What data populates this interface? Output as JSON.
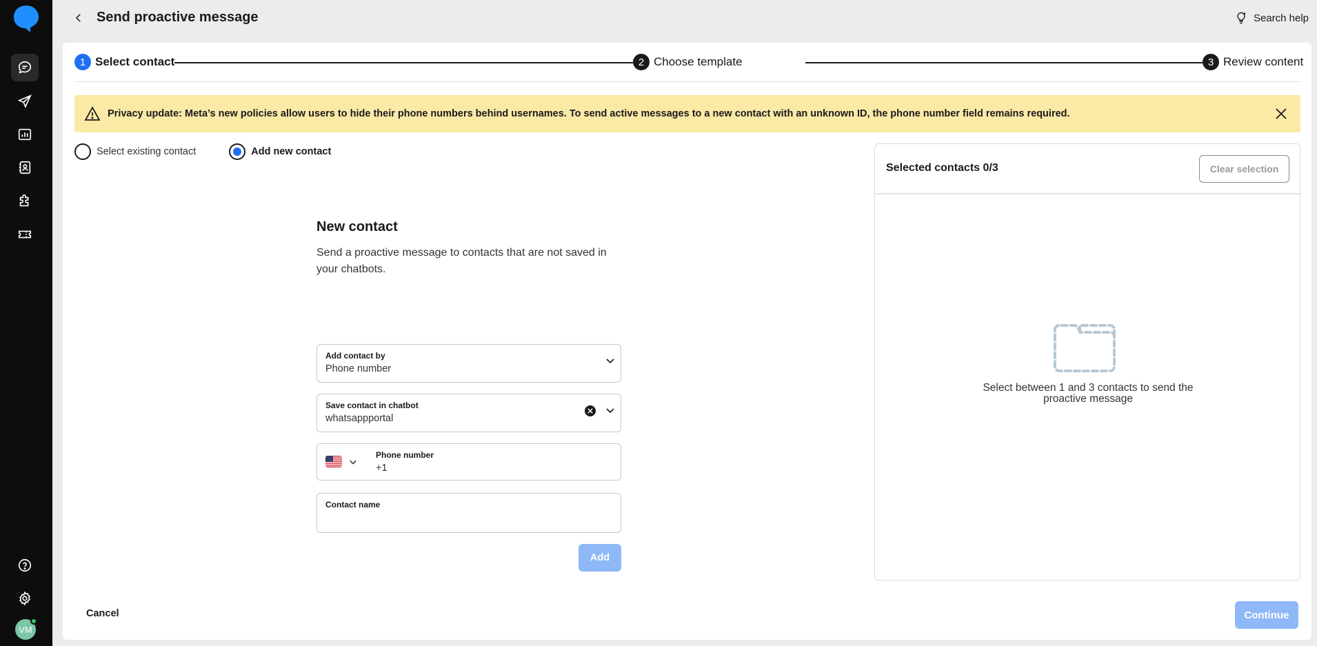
{
  "header": {
    "title": "Send proactive message",
    "search_help": "Search help"
  },
  "stepper": {
    "steps": [
      {
        "num": "1",
        "label": "Select contact"
      },
      {
        "num": "2",
        "label": "Choose template"
      },
      {
        "num": "3",
        "label": "Review content"
      }
    ]
  },
  "banner": {
    "text": "Privacy update: Meta’s new policies allow users to hide their phone numbers behind usernames. To send active messages to a new contact with an unknown ID, the phone number field remains required."
  },
  "contact_mode": {
    "options": [
      {
        "label": "Select existing contact",
        "selected": false
      },
      {
        "label": "Add new contact",
        "selected": true
      }
    ]
  },
  "new_contact": {
    "title": "New contact",
    "description": "Send a proactive message to contacts that are not saved in your chatbots.",
    "add_by": {
      "label": "Add contact by",
      "value": "Phone number"
    },
    "chatbot": {
      "label": "Save contact in chatbot",
      "value": "whatsappportal"
    },
    "phone": {
      "label": "Phone number",
      "value": "+1",
      "country_icon": "us-flag-icon"
    },
    "contact_name": {
      "label": "Contact name",
      "value": ""
    },
    "add_button": "Add"
  },
  "selected_contacts": {
    "title": "Selected contacts 0/3",
    "clear_button": "Clear selection",
    "empty_text": "Select between 1 and 3 contacts to send the proactive message"
  },
  "footer": {
    "cancel": "Cancel",
    "continue": "Continue"
  },
  "user": {
    "initials": "VM"
  },
  "colors": {
    "accent": "#1f6ff2",
    "banner": "#fbe9a6",
    "disabled_button": "#8fb8f7",
    "rail": "#0d0d0d"
  }
}
